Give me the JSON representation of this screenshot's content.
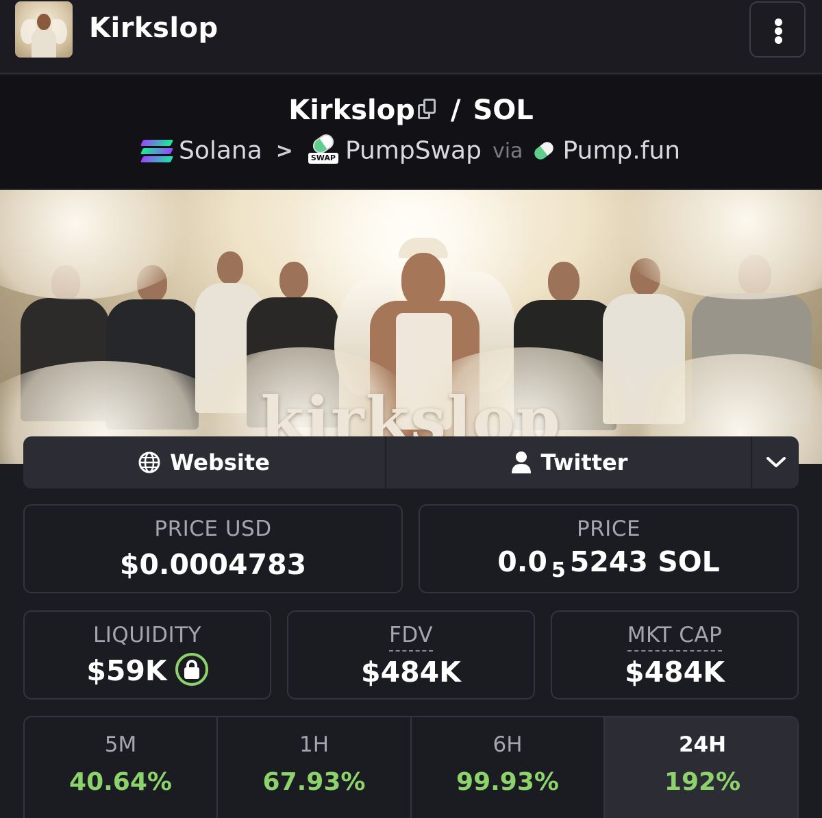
{
  "header": {
    "title": "Kirkslop",
    "menu_icon": "kebab-menu-icon"
  },
  "pair": {
    "base": "Kirkslop",
    "separator": "/",
    "quote": "SOL"
  },
  "chain": {
    "name": "Solana",
    "dex": "PumpSwap",
    "dex_badge": "SWAP",
    "via_label": "via",
    "launchpad": "Pump.fun"
  },
  "banner": {
    "wordmark": "kirkslop"
  },
  "links": {
    "website": "Website",
    "twitter": "Twitter",
    "more_icon": "chevron-down-icon"
  },
  "stats": {
    "price_usd": {
      "label": "PRICE USD",
      "value": "$0.0004783"
    },
    "price": {
      "label": "PRICE",
      "prefix": "0.0",
      "zeros": "5",
      "digits": "5243",
      "unit": "SOL"
    },
    "liquidity": {
      "label": "LIQUIDITY",
      "value": "$59K"
    },
    "fdv": {
      "label": "FDV",
      "value": "$484K"
    },
    "mkt_cap": {
      "label": "MKT CAP",
      "value": "$484K"
    }
  },
  "timeframes": [
    {
      "label": "5M",
      "change": "40.64%"
    },
    {
      "label": "1H",
      "change": "67.93%"
    },
    {
      "label": "6H",
      "change": "99.93%"
    },
    {
      "label": "24H",
      "change": "192%",
      "active": true
    }
  ],
  "colors": {
    "background": "#1b1b22",
    "positive": "#8bd36a",
    "card_border": "#34343e",
    "muted": "#a6a6b0"
  }
}
